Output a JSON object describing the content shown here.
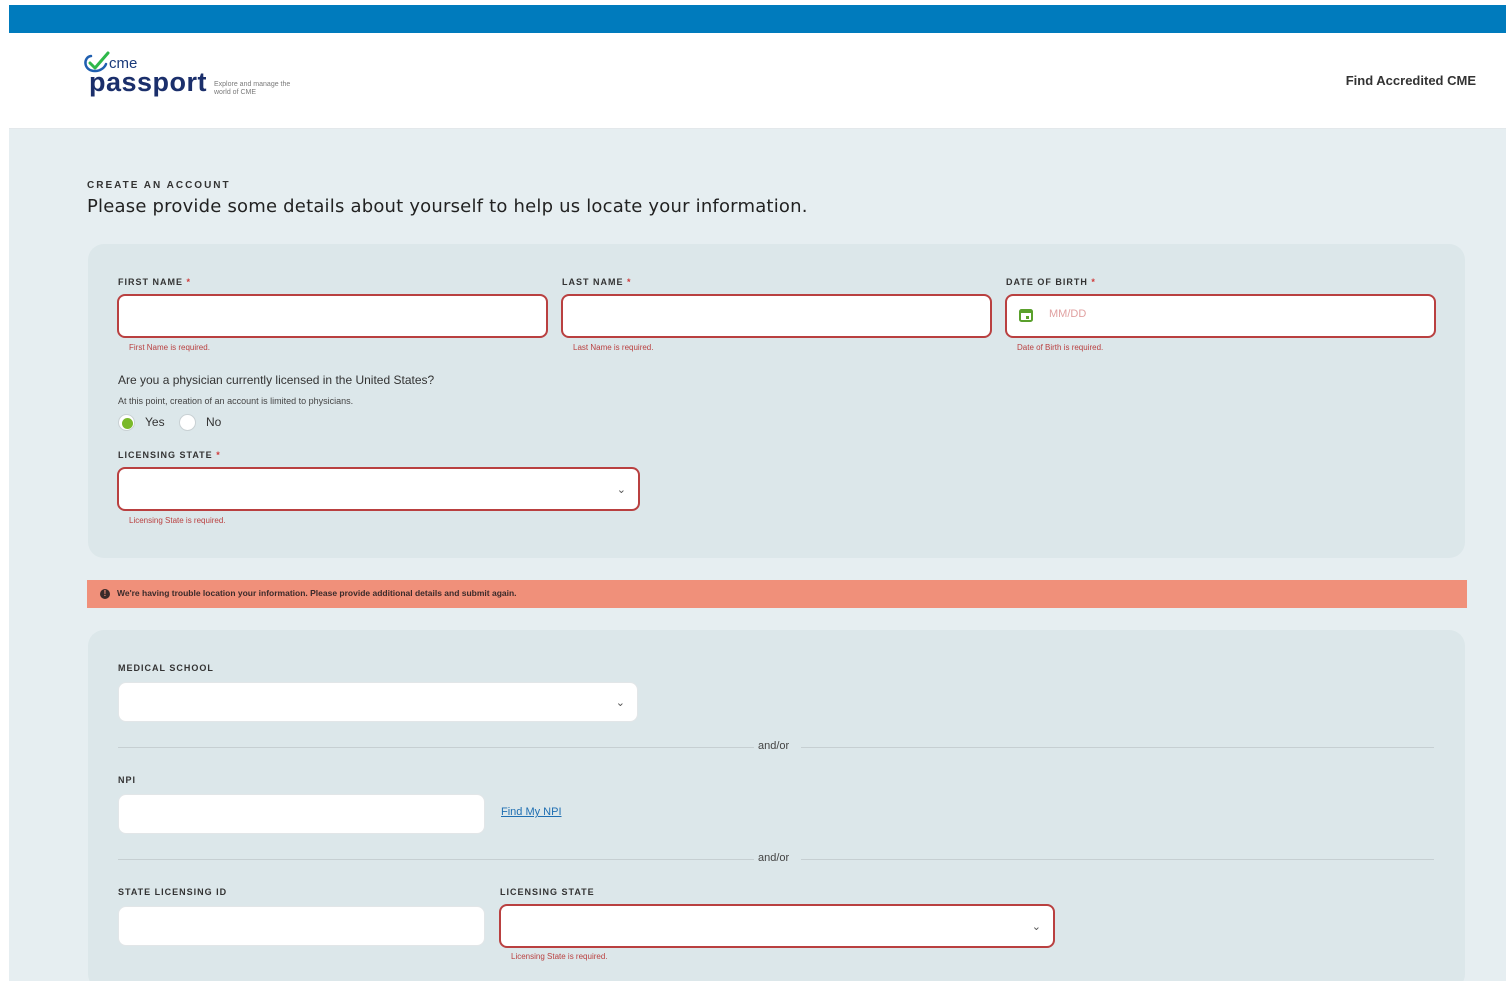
{
  "colors": {
    "topbar": "#007bbd",
    "error": "#b94040",
    "alert_bg": "#f0907a",
    "accent_green": "#7ab929"
  },
  "header": {
    "logo_small": "cme",
    "logo_big": "passport",
    "tagline": "Explore and manage the world of CME",
    "nav_link": "Find Accredited CME"
  },
  "intro": {
    "kicker": "CREATE AN ACCOUNT",
    "lead": "Please provide some details about yourself to help us locate your information."
  },
  "form1": {
    "first_name": {
      "label": "FIRST NAME",
      "required": "*",
      "value": "",
      "error": "First Name is required."
    },
    "last_name": {
      "label": "LAST NAME",
      "required": "*",
      "value": "",
      "error": "Last Name is required."
    },
    "dob": {
      "label": "DATE OF BIRTH",
      "required": "*",
      "placeholder": "MM/DD",
      "icon": "calendar-icon",
      "error": "Date of Birth is required."
    },
    "question": "Are you a physician currently licensed in the United States?",
    "hint": "At this point, creation of an account is limited to physicians.",
    "radio_yes": "Yes",
    "radio_no": "No",
    "selected": "Yes",
    "licensing_state": {
      "label": "LICENSING STATE",
      "required": "*",
      "value": "",
      "error": "Licensing State is required."
    }
  },
  "alert": {
    "icon": "alert-circle-icon",
    "text": "We're having trouble location your information. Please provide additional details and submit again."
  },
  "form2": {
    "medical_school": {
      "label": "MEDICAL SCHOOL",
      "value": ""
    },
    "separator": "and/or",
    "npi": {
      "label": "NPI",
      "value": "",
      "link": "Find My NPI"
    },
    "state_licensing_id": {
      "label": "STATE LICENSING ID",
      "value": ""
    },
    "licensing_state": {
      "label": "LICENSING STATE",
      "value": "",
      "error": "Licensing State is required."
    }
  }
}
